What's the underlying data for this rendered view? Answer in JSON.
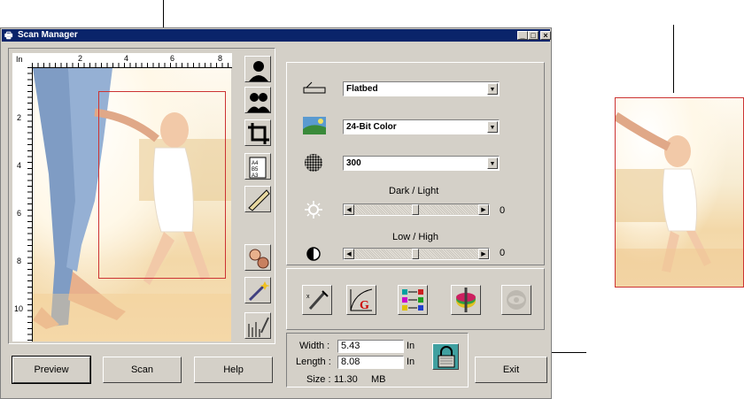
{
  "window": {
    "title": "Scan Manager",
    "title_buttons": [
      "_",
      "□",
      "×"
    ]
  },
  "ruler": {
    "unit": "In",
    "top_marks": [
      "2",
      "4",
      "6",
      "8"
    ],
    "left_marks": [
      "2",
      "4",
      "6",
      "8",
      "10"
    ]
  },
  "tools": [
    {
      "name": "portrait-icon"
    },
    {
      "name": "group-icon"
    },
    {
      "name": "crop-icon"
    },
    {
      "name": "paper-size-icon"
    },
    {
      "name": "ruler-icon"
    },
    {
      "name": "faces-icon"
    },
    {
      "name": "magic-wand-icon"
    },
    {
      "name": "eyedropper-graph-icon"
    }
  ],
  "settings": {
    "source": {
      "value": "Flatbed",
      "icon": "flatbed-icon"
    },
    "mode": {
      "value": "24-Bit Color",
      "icon": "color-mode-icon"
    },
    "resolution": {
      "value": "300",
      "icon": "halftone-icon"
    },
    "brightness": {
      "label": "Dark / Light",
      "value": "0",
      "level": 0.5,
      "icon": "sun-icon"
    },
    "contrast": {
      "label": "Low / High",
      "value": "0",
      "level": 0.5,
      "icon": "contrast-icon"
    }
  },
  "adjust_tools": [
    "eyedropper-icon",
    "curve-g-icon",
    "color-balance-icon",
    "hue-icon",
    "eye-icon"
  ],
  "dimensions": {
    "width_label": "Width :",
    "width_value": "5.43",
    "width_unit": "In",
    "length_label": "Length :",
    "length_value": "8.08",
    "length_unit": "In",
    "size_label": "Size :",
    "size_value": "11.30",
    "size_unit": "MB"
  },
  "buttons": {
    "preview": "Preview",
    "scan": "Scan",
    "help": "Help",
    "exit": "Exit"
  },
  "colors": {
    "titlebar": "#0a246a",
    "window": "#d4d0c8",
    "selection": "#cc3333"
  }
}
